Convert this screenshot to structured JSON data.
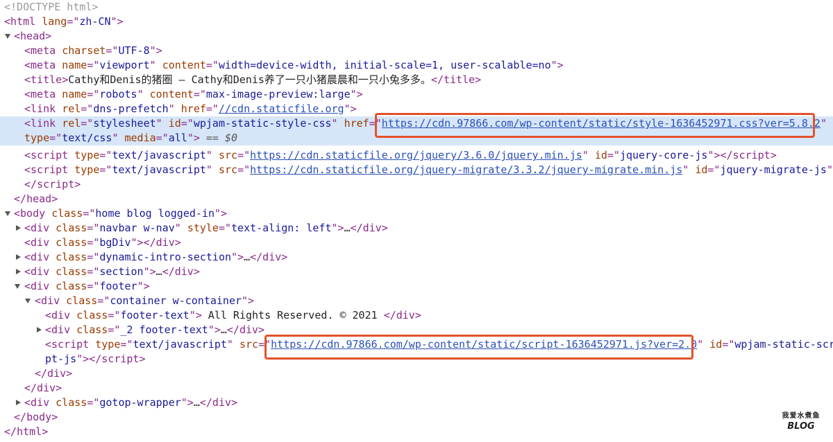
{
  "dom_tree": {
    "doctype": "<!DOCTYPE html>",
    "html_open_tag": "html",
    "html_lang_attr": "lang",
    "html_lang_val": "zh-CN",
    "head_tag": "head",
    "meta_charset_attr": "charset",
    "meta_charset_val": "UTF-8",
    "meta_name_attr": "name",
    "meta_viewport_val": "viewport",
    "meta_content_attr": "content",
    "meta_viewport_content": "width=device-width, initial-scale=1, user-scalable=no",
    "title_tag": "title",
    "title_text": "Cathy和Denis的猪圈 – Cathy和Denis养了一只小猪晨晨和一只小兔多多。",
    "meta_robots_val": "robots",
    "meta_robots_content": "max-image-preview:large",
    "link_tag": "link",
    "rel_attr": "rel",
    "rel_dns_val": "dns-prefetch",
    "href_attr": "href",
    "dns_href": "//cdn.staticfile.org",
    "rel_stylesheet_val": "stylesheet",
    "id_attr": "id",
    "stylesheet_id": "wpjam-static-style-css",
    "stylesheet_href": "https://cdn.97866.com/wp-content/static/style-1636452971.css?ver=5.8.2",
    "type_attr": "type",
    "type_css_val": "text/css",
    "media_attr": "media",
    "media_val": "all",
    "selected_marker": "== $0",
    "script_tag": "script",
    "type_js_val": "text/javascript",
    "src_attr": "src",
    "jquery_src": "https://cdn.staticfile.org/jquery/3.6.0/jquery.min.js",
    "jquery_id": "jquery-core-js",
    "migrate_src": "https://cdn.staticfile.org/jquery-migrate/3.3.2/jquery-migrate.min.js",
    "migrate_id": "jquery-migrate-js",
    "body_tag": "body",
    "class_attr": "class",
    "body_class": "home blog logged-in",
    "div_tag": "div",
    "navbar_class": "navbar w-nav",
    "style_attr": "style",
    "navbar_style": "text-align: left",
    "ellipsis": "…",
    "bgdiv_class": "bgDiv",
    "intro_class": "dynamic-intro-section",
    "section_class": "section",
    "footer_class": "footer",
    "container_class": "container w-container",
    "footer_text_class": "footer-text",
    "footer_text_content": " All Rights Reserved. © 2021 ",
    "footer_text2_class": "_2 footer-text",
    "script2_src": "https://cdn.97866.com/wp-content/static/script-1636452971.js?ver=2.0",
    "script2_id_part1": "wpjam-static-scri",
    "script2_id_part2": "pt-js",
    "gotop_class": "gotop-wrapper",
    "html_close": "html"
  },
  "watermark": {
    "top": "我爱水煮鱼",
    "bottom": "BLOG"
  },
  "colors": {
    "highlight_border": "#e4512a",
    "selected_row_bg": "#d6e6f8"
  }
}
